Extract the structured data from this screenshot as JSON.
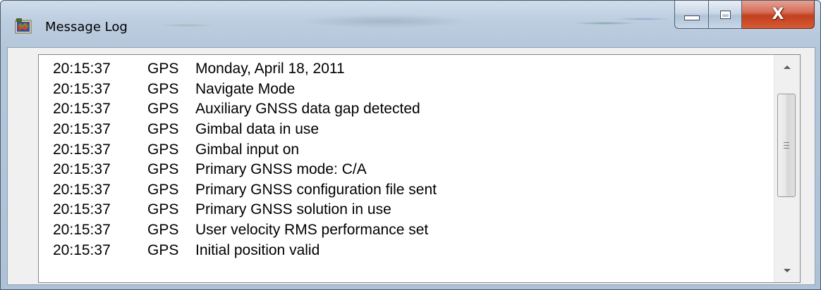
{
  "window": {
    "title": "Message Log",
    "icon": "app-globe-icon",
    "controls": {
      "minimize_icon": "minimize-icon",
      "maximize_icon": "maximize-icon",
      "close_label": "X"
    }
  },
  "log": {
    "rows": [
      {
        "time": "20:15:37",
        "source": "GPS",
        "message": "Monday, April 18, 2011"
      },
      {
        "time": "20:15:37",
        "source": "GPS",
        "message": "Navigate Mode"
      },
      {
        "time": "20:15:37",
        "source": "GPS",
        "message": "Auxiliary GNSS data gap detected"
      },
      {
        "time": "20:15:37",
        "source": "GPS",
        "message": "Gimbal data in use"
      },
      {
        "time": "20:15:37",
        "source": "GPS",
        "message": "Gimbal input on"
      },
      {
        "time": "20:15:37",
        "source": "GPS",
        "message": "Primary GNSS mode: C/A"
      },
      {
        "time": "20:15:37",
        "source": "GPS",
        "message": "Primary GNSS configuration file sent"
      },
      {
        "time": "20:15:37",
        "source": "GPS",
        "message": "Primary GNSS solution in use"
      },
      {
        "time": "20:15:37",
        "source": "GPS",
        "message": "User velocity RMS performance set"
      },
      {
        "time": "20:15:37",
        "source": "GPS",
        "message": "Initial position valid"
      }
    ]
  },
  "scrollbar": {
    "up_icon": "scroll-up-arrow-icon",
    "down_icon": "scroll-down-arrow-icon",
    "thumb_icon": "scroll-grip-icon"
  },
  "colors": {
    "close_button": "#c7462a",
    "frame": "#b9cade"
  }
}
